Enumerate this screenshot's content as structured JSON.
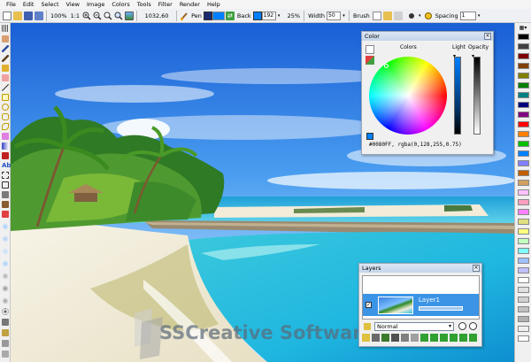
{
  "menu": [
    "File",
    "Edit",
    "Select",
    "View",
    "Image",
    "Colors",
    "Tools",
    "Filter",
    "Render",
    "Help"
  ],
  "toolbar": {
    "zoom": "100%",
    "ratio": "1:1",
    "coords": "1032,60",
    "pen_label": "Pen",
    "pen_color": "#0080ff",
    "back_label": "Back",
    "back_color": "#0080ff",
    "alpha_value": "192",
    "alpha_percent": "25%",
    "width_label": "Width",
    "width_value": "50",
    "brush_label": "Brush",
    "spacing_label": "Spacing",
    "spacing_value": "1"
  },
  "color_panel": {
    "title": "Color",
    "colors_label": "Colors",
    "light_label": "Light",
    "opacity_label": "Opacity",
    "readout": "#0080FF, rgba(0,128,255,0.75)",
    "current_color": "#0080ff"
  },
  "layers_panel": {
    "title": "Layers",
    "layer_name": "Layer1",
    "blend_mode": "Normal"
  },
  "watermark": "SSCreative Software",
  "palette_colors": [
    "#000000",
    "#404040",
    "#800000",
    "#804000",
    "#808000",
    "#008000",
    "#008080",
    "#000080",
    "#800080",
    "#ff0000",
    "#ff8000",
    "#00c000",
    "#0080ff",
    "#8080ff",
    "#c06000",
    "#d0a060",
    "#ffc0ff",
    "#ffa0c0",
    "#ff80ff",
    "#e0e080",
    "#ffff80",
    "#c0ffc0",
    "#80ffff",
    "#a0c0ff",
    "#c0c0ff",
    "#ffffff",
    "#e0e0e0",
    "#d0d0d0",
    "#c0c0c0",
    "#b0b0b0",
    "#f0f0f0",
    "#ffffff"
  ]
}
